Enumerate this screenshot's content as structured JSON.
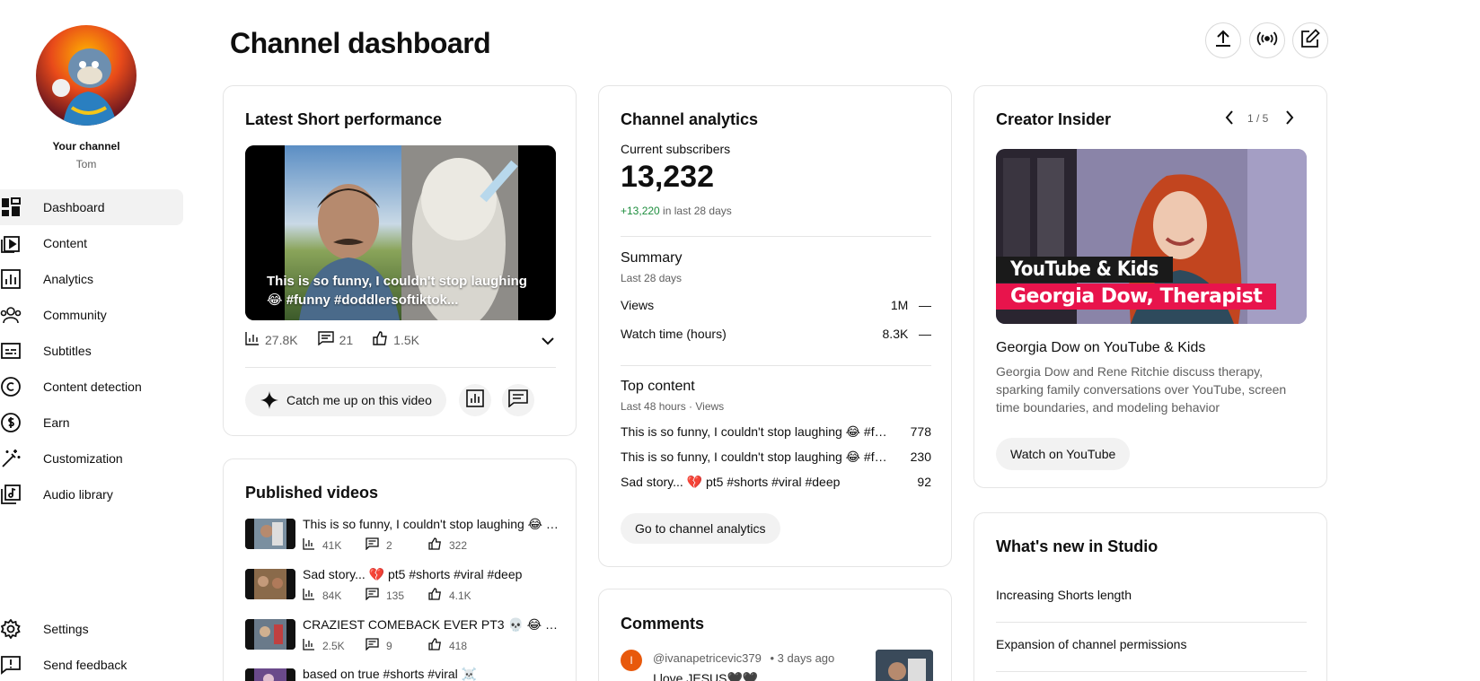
{
  "sidebar": {
    "your_channel_label": "Your channel",
    "channel_name": "Tom",
    "items": [
      {
        "label": "Dashboard",
        "icon": "dashboard-icon",
        "active": true
      },
      {
        "label": "Content",
        "icon": "content-icon"
      },
      {
        "label": "Analytics",
        "icon": "analytics-icon"
      },
      {
        "label": "Community",
        "icon": "community-icon"
      },
      {
        "label": "Subtitles",
        "icon": "subtitles-icon"
      },
      {
        "label": "Content detection",
        "icon": "copyright-icon"
      },
      {
        "label": "Earn",
        "icon": "dollar-icon"
      },
      {
        "label": "Customization",
        "icon": "magic-wand-icon"
      },
      {
        "label": "Audio library",
        "icon": "audio-library-icon"
      }
    ],
    "bottom_items": [
      {
        "label": "Settings",
        "icon": "gear-icon"
      },
      {
        "label": "Send feedback",
        "icon": "feedback-icon"
      }
    ]
  },
  "header": {
    "title": "Channel dashboard",
    "buttons": [
      "upload-icon",
      "go-live-icon",
      "create-post-icon"
    ]
  },
  "latest_short": {
    "title": "Latest Short performance",
    "caption": "This is so funny, I couldn't stop laughing 😂 #funny #doddlersoftiktok...",
    "views": "27.8K",
    "comments": "21",
    "likes": "1.5K",
    "catch_up_label": "Catch me up on this video"
  },
  "published_videos": {
    "title": "Published videos",
    "items": [
      {
        "title": "This is so funny, I couldn't stop laughing 😂 #funny #doddlersoftiktok",
        "views": "41K",
        "comments": "2",
        "likes": "322"
      },
      {
        "title": "Sad story... 💔 pt5 #shorts #viral #deep",
        "views": "84K",
        "comments": "135",
        "likes": "4.1K"
      },
      {
        "title": "CRAZIEST COMEBACK EVER PT3 💀 😂 #comedy",
        "views": "2.5K",
        "comments": "9",
        "likes": "418"
      },
      {
        "title": "based on true #shorts #viral ☠️"
      }
    ]
  },
  "analytics": {
    "title": "Channel analytics",
    "subs_label": "Current subscribers",
    "subs_value": "13,232",
    "subs_change": "+13,220",
    "subs_change_suffix": " in last 28 days",
    "summary_title": "Summary",
    "summary_period": "Last 28 days",
    "metrics": [
      {
        "label": "Views",
        "value": "1M",
        "trend": "—"
      },
      {
        "label": "Watch time (hours)",
        "value": "8.3K",
        "trend": "—"
      }
    ],
    "top_title": "Top content",
    "top_period": "Last 48 hours · Views",
    "top_items": [
      {
        "title": "This is so funny, I couldn't stop laughing 😂 #funny #doddlersoftiktok",
        "views": "778"
      },
      {
        "title": "This is so funny, I couldn't stop laughing 😂 #funny #doddlersoftiktok",
        "views": "230"
      },
      {
        "title": "Sad story... 💔 pt5 #shorts #viral #deep",
        "views": "92"
      }
    ],
    "go_button": "Go to channel analytics"
  },
  "comments": {
    "title": "Comments",
    "author_initial": "I",
    "author": "@ivanapetricevic379",
    "time": "• 3 days ago",
    "text": "I love JESUS🖤🖤"
  },
  "creator_insider": {
    "title": "Creator Insider",
    "pager": "1 / 5",
    "thumb_line1": "YouTube & Kids",
    "thumb_line2": "Georgia Dow, Therapist",
    "video_title": "Georgia Dow on YouTube & Kids",
    "description": "Georgia Dow and Rene Ritchie discuss therapy, sparking family conversations over YouTube, screen time boundaries, and modeling behavior",
    "watch_button": "Watch on YouTube"
  },
  "whats_new": {
    "title": "What's new in Studio",
    "items": [
      "Increasing Shorts length",
      "Expansion of channel permissions"
    ]
  },
  "colors": {
    "accent_green": "#1e8e3e",
    "avatar_orange": "#e8590c",
    "insider_pink": "#e8144c"
  }
}
